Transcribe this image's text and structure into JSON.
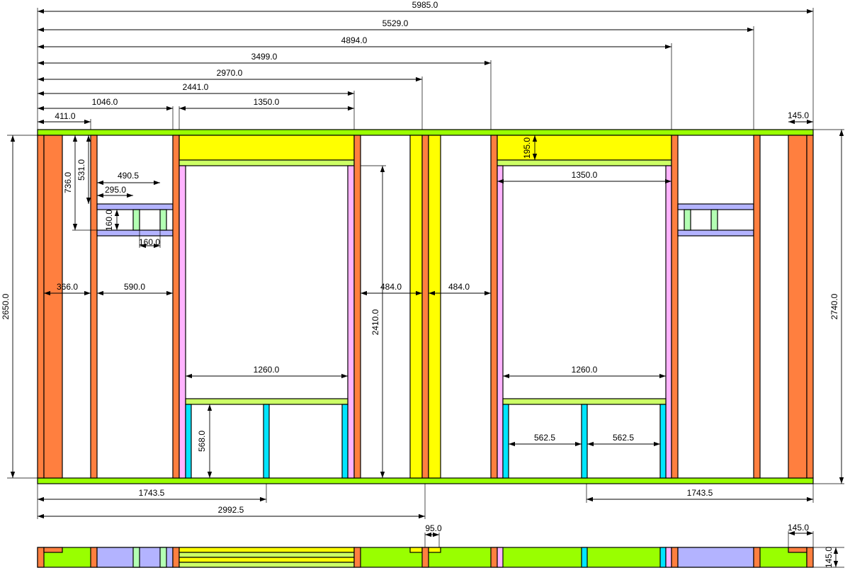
{
  "drawing": {
    "type": "timber frame wall elevation with plan strip",
    "colors": {
      "plate": "#99ff00",
      "stud": "#ff7f3f",
      "header": "#ffff00",
      "sill": "#ccff66",
      "jack": "#ffb3ff",
      "cripple": "#00e5ff",
      "noggin": "#b3b3ff",
      "short_stud": "#b3ffb3",
      "line": "#000000",
      "background": "#ffffff"
    }
  },
  "top_dims": {
    "d5985": "5985.0",
    "d5529": "5529.0",
    "d4894": "4894.0",
    "d3499": "3499.0",
    "d2970": "2970.0",
    "d2441": "2441.0",
    "d1046": "1046.0",
    "d1350a": "1350.0",
    "d411": "411.0",
    "d145": "145.0"
  },
  "inner_dims": {
    "d736": "736.0",
    "d531": "531.0",
    "d490": "490.5",
    "d295": "295.0",
    "d160v": "160.0",
    "d160h": "160.0",
    "d366": "366.0",
    "d590": "590.0",
    "d484a": "484.0",
    "d484b": "484.0",
    "d2410": "2410.0",
    "d195": "195.0",
    "d1350b": "1350.0",
    "d1260a": "1260.0",
    "d1260b": "1260.0",
    "d568": "568.0",
    "d562a": "562.5",
    "d562b": "562.5"
  },
  "side_dims": {
    "d2650": "2650.0",
    "d2740": "2740.0"
  },
  "bottom_dims": {
    "d1743a": "1743.5",
    "d1743b": "1743.5",
    "d2992": "2992.5"
  },
  "plan_dims": {
    "d95": "95.0",
    "d145": "145.0",
    "d145v": "145.0"
  }
}
